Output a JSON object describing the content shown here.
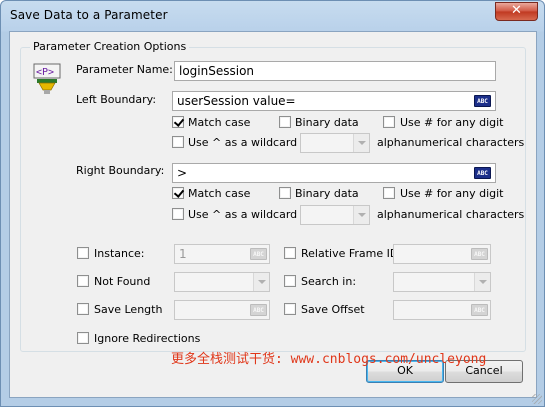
{
  "window": {
    "title": "Save Data to a Parameter",
    "close_glyph": "✕"
  },
  "group": {
    "title": "Parameter Creation Options"
  },
  "param_icon": {
    "glyph": "<P>",
    "name": "parameter-icon"
  },
  "parameter_name": {
    "label": "Parameter Name:",
    "value": "loginSession"
  },
  "left_boundary": {
    "label": "Left Boundary:",
    "value": "userSession value=",
    "abc": "ABC",
    "match_case": {
      "label": "Match case",
      "checked": true
    },
    "binary_data": {
      "label": "Binary data",
      "checked": false
    },
    "use_hash": {
      "label": "Use # for any digit",
      "checked": false
    },
    "use_caret": {
      "label": "Use ^ as a wildcard for",
      "checked": false
    },
    "alnum_label": "alphanumerical characters"
  },
  "right_boundary": {
    "label": "Right Boundary:",
    "value": ">",
    "abc": "ABC",
    "match_case": {
      "label": "Match case",
      "checked": true
    },
    "binary_data": {
      "label": "Binary data",
      "checked": false
    },
    "use_hash": {
      "label": "Use # for any digit",
      "checked": false
    },
    "use_caret": {
      "label": "Use ^ as a wildcard for",
      "checked": false
    },
    "alnum_label": "alphanumerical characters"
  },
  "instance": {
    "label": "Instance:",
    "value": "1",
    "checked": false
  },
  "relative_frame": {
    "label": "Relative Frame ID:",
    "checked": false
  },
  "not_found": {
    "label": "Not Found",
    "checked": false
  },
  "search_in": {
    "label": "Search in:",
    "checked": false
  },
  "save_length": {
    "label": "Save Length",
    "checked": false
  },
  "save_offset": {
    "label": "Save Offset",
    "checked": false
  },
  "ignore_redirections": {
    "label": "Ignore Redirections",
    "checked": false
  },
  "buttons": {
    "ok": "OK",
    "cancel": "Cancel"
  },
  "watermark": "更多全栈测试干货: www.cnblogs.com/uncleyong",
  "colors": {
    "abc_active": "#1c2f8a",
    "watermark": "#e0371a",
    "title_bar": "#b9d1ea"
  }
}
